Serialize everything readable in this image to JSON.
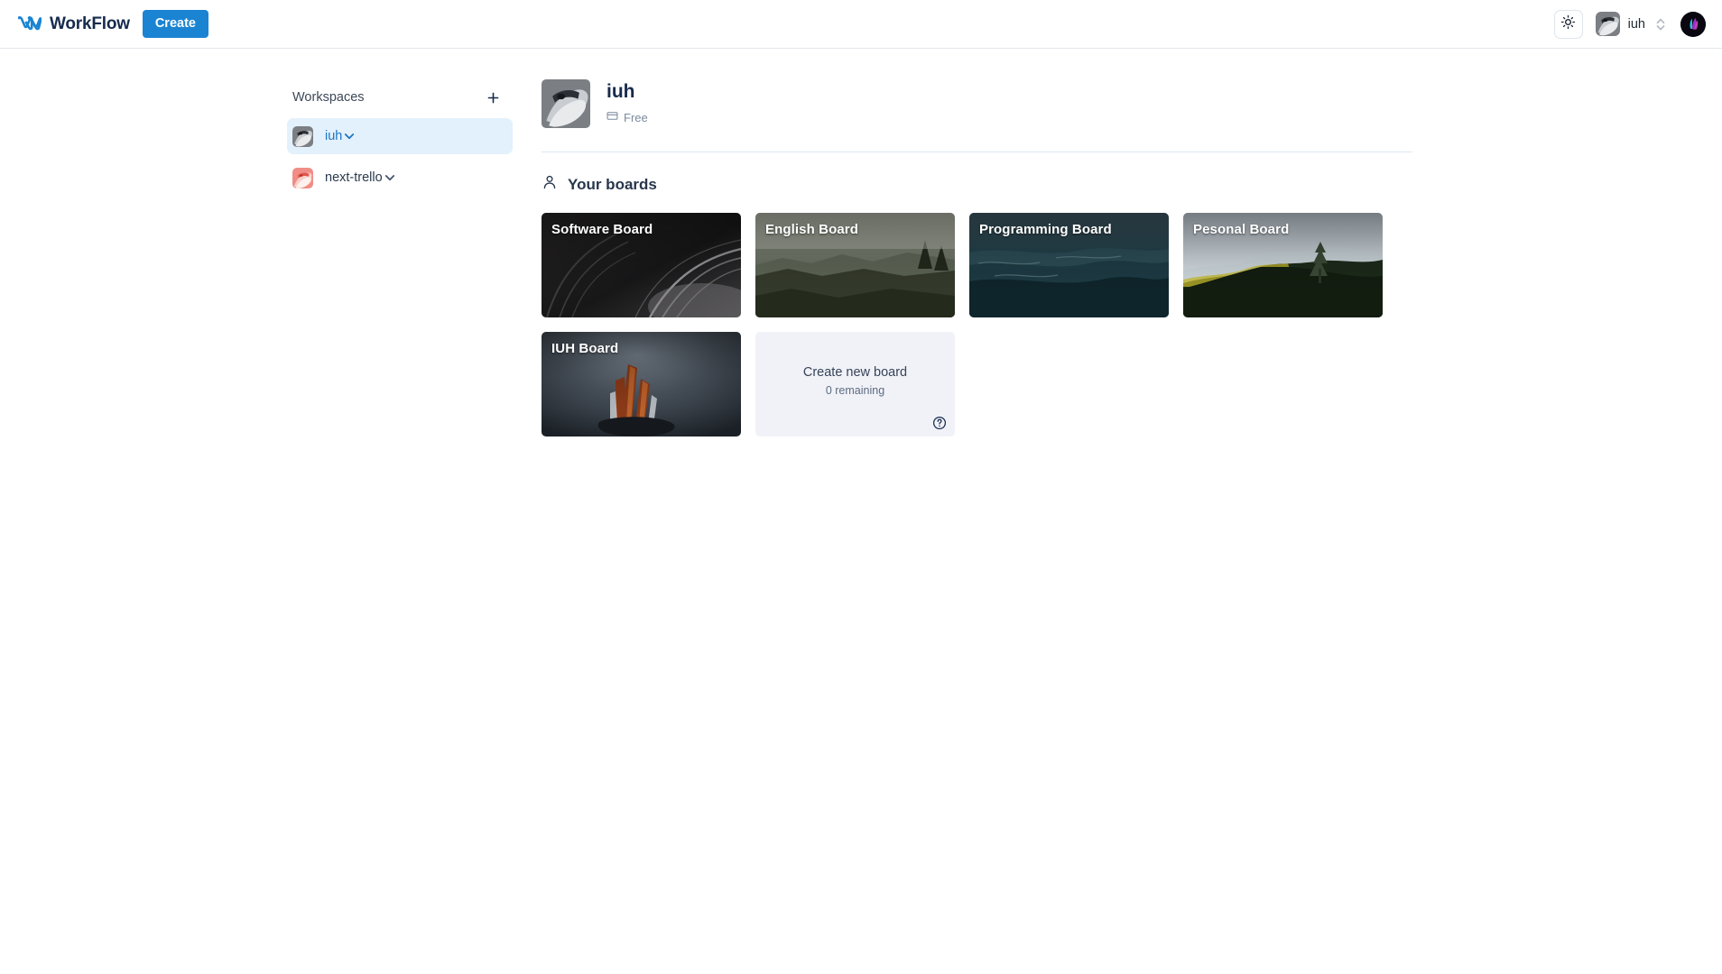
{
  "navbar": {
    "brand_name": "WorkFlow",
    "brand_logo_icon": "workflow-logo-icon",
    "create_label": "Create",
    "theme_toggle_icon": "sun-icon",
    "workspace_switcher_name": "iuh",
    "workspace_switcher_avatar_icon": "dolphin-avatar",
    "updown_icon": "chevron-up-down-icon",
    "user_avatar_icon": "user-avatar"
  },
  "sidebar": {
    "heading": "Workspaces",
    "add_icon": "plus-icon",
    "items": [
      {
        "label": "iuh",
        "chevron_icon": "chevron-down-icon",
        "active": true
      },
      {
        "label": "next-trello",
        "chevron_icon": "chevron-down-icon",
        "active": false
      }
    ]
  },
  "workspace_header": {
    "title": "iuh",
    "plan_icon": "credit-card-icon",
    "plan_label": "Free",
    "avatar_icon": "dolphin-avatar"
  },
  "boards_section": {
    "icon": "person-icon",
    "title": "Your boards",
    "boards": [
      {
        "title": "Software Board"
      },
      {
        "title": "English Board"
      },
      {
        "title": "Programming Board"
      },
      {
        "title": "Pesonal Board"
      },
      {
        "title": "IUH Board"
      }
    ],
    "create_card": {
      "title": "Create new board",
      "subtitle": "0 remaining",
      "help_icon": "question-circle-icon"
    }
  },
  "colors": {
    "accent": "#1a84d2",
    "active_bg": "#e3f1fd",
    "active_text": "#1b74c4",
    "text_primary": "#172b4d",
    "text_muted": "#7b8a9e",
    "create_card_bg": "#f0f2f7",
    "divider": "#dfe6f2"
  }
}
